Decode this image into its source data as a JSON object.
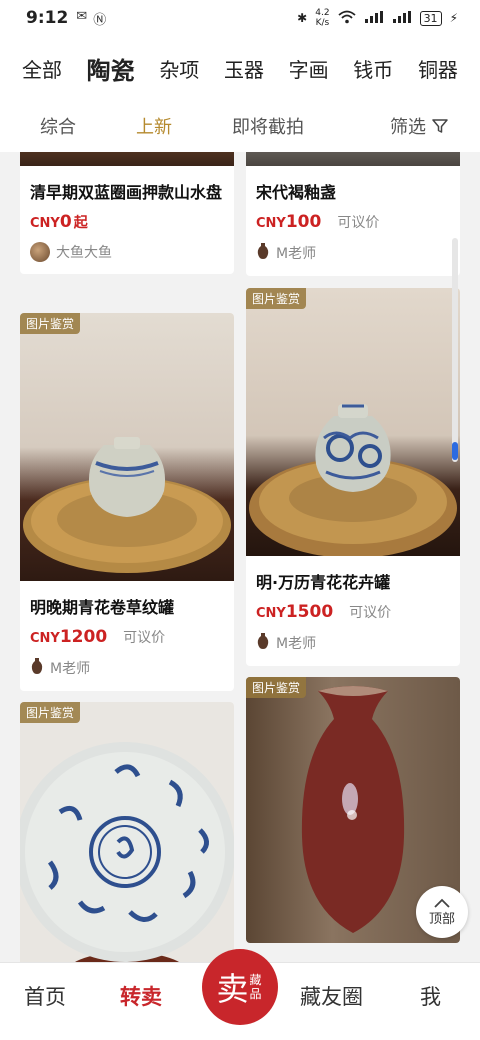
{
  "status_bar": {
    "time": "9:12",
    "net_speed_top": "4.2",
    "net_speed_bottom": "K/s",
    "battery": "31"
  },
  "categories": [
    "全部",
    "陶瓷",
    "杂项",
    "玉器",
    "字画",
    "钱币",
    "铜器"
  ],
  "sort_options": [
    "综合",
    "上新",
    "即将截拍"
  ],
  "filter_label": "筛选",
  "image_tag": "图片鉴赏",
  "currency": "CNY",
  "items": [
    {
      "title": "清早期双蓝圈画押款山水盘",
      "price": "0",
      "price_suffix": "起",
      "negotiable": "",
      "seller": "大鱼大鱼"
    },
    {
      "title": "宋代褐釉盏",
      "price": "100",
      "price_suffix": "",
      "negotiable": "可议价",
      "seller": "M老师"
    },
    {
      "title": "明晚期青花卷草纹罐",
      "price": "1200",
      "price_suffix": "",
      "negotiable": "可议价",
      "seller": "M老师"
    },
    {
      "title": "明·万历青花花卉罐",
      "price": "1500",
      "price_suffix": "",
      "negotiable": "可议价",
      "seller": "M老师"
    }
  ],
  "back_to_top": "顶部",
  "bottom_nav": {
    "home": "首页",
    "resell": "转卖",
    "sell_main": "卖",
    "sell_sub": "藏品",
    "circle": "藏友圈",
    "me": "我"
  },
  "colors": {
    "accent_gold": "#b58a2e",
    "price_red": "#cc2222",
    "brand_red": "#c8262b"
  }
}
